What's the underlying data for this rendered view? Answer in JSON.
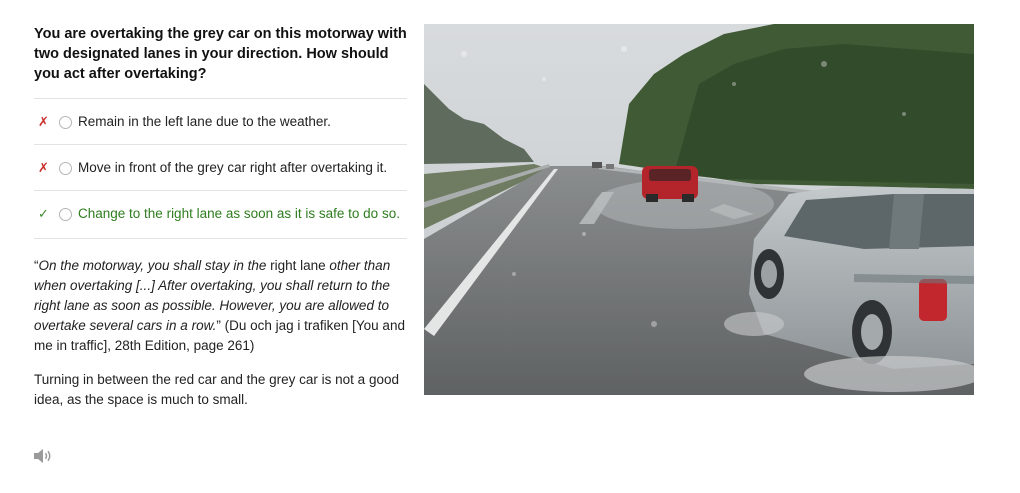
{
  "question": "You are overtaking the grey car on this motorway with two designated lanes in your direction. How should you act after overtaking?",
  "answers": [
    {
      "mark": "✗",
      "status": "wrong",
      "text": "Remain in the left lane due to the weather."
    },
    {
      "mark": "✗",
      "status": "wrong",
      "text": "Move in front of the grey car right after overtaking it."
    },
    {
      "mark": "✓",
      "status": "correct",
      "text": "Change to the right lane as soon as it is safe to do so."
    }
  ],
  "explanation": {
    "q_open": "“",
    "part1": "On the motorway, you shall stay in the",
    "part2": " right lane ",
    "part3": "other than when overtaking [...] After overtaking, you shall return to the right lane as soon as possible. However, you are allowed to overtake several cars in a row.",
    "q_close": "”",
    "source": " (Du och jag i trafiken [You and me in traffic], 28th Edition, page 261)"
  },
  "explanation2": "Turning in between the red car and the grey car is not a good idea, as the space is much to small.",
  "icons": {
    "audio": "speaker-icon"
  },
  "colors": {
    "wrong": "#c9302c",
    "correct": "#2e7d1e"
  }
}
